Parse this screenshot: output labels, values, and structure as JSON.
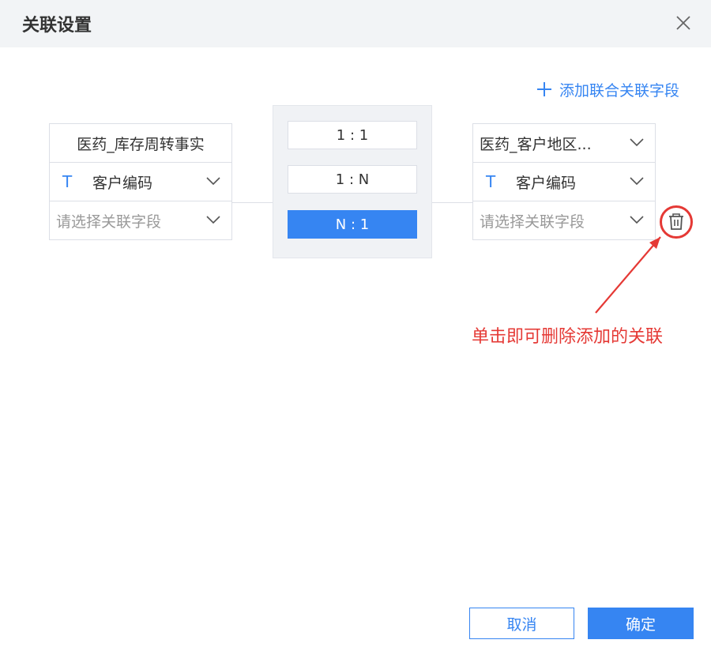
{
  "dialog": {
    "title": "关联设置"
  },
  "toolbar": {
    "add_joint_label": "添加联合关联字段"
  },
  "left_table": {
    "name": "医药_库存周转事实",
    "field_type_icon": "T",
    "field": "客户编码",
    "placeholder": "请选择关联字段"
  },
  "relations": {
    "options": [
      "1 : 1",
      "1 : N",
      "N : 1"
    ],
    "selected": "N : 1"
  },
  "right_table": {
    "name": "医药_客户地区...",
    "field_type_icon": "T",
    "field": "客户编码",
    "placeholder": "请选择关联字段"
  },
  "annotation": {
    "text": "单击即可删除添加的关联",
    "color": "#e53935"
  },
  "footer": {
    "cancel_label": "取消",
    "ok_label": "确定"
  },
  "colors": {
    "accent": "#3685f2",
    "header_bg": "#f2f4f6"
  }
}
